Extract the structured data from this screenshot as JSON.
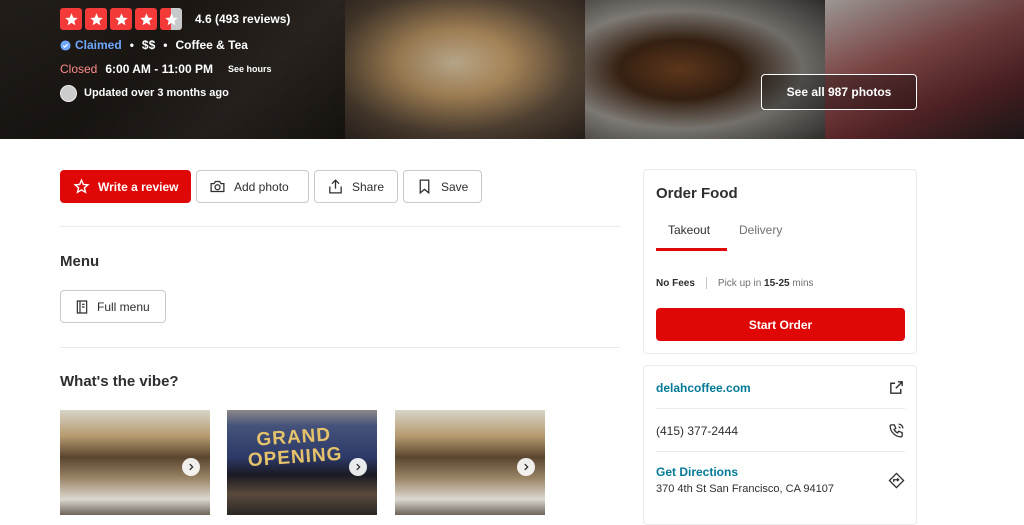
{
  "hero": {
    "rating_text": "4.6 (493 reviews)",
    "claimed": "Claimed",
    "price": "$$",
    "category": "Coffee & Tea",
    "status": "Closed",
    "hours": "6:00 AM - 11:00 PM",
    "see_hours": "See hours",
    "updated": "Updated over 3 months ago",
    "see_photos": "See all 987 photos",
    "star_color": "#f43939",
    "stars": 4.5
  },
  "actions": {
    "write_review": "Write a review",
    "add_photo": "Add photo",
    "share": "Share",
    "save": "Save"
  },
  "menu": {
    "title": "Menu",
    "full_menu": "Full menu"
  },
  "vibe": {
    "title": "What's the vibe?",
    "banner_text": "GRAND OPENING"
  },
  "order": {
    "title": "Order Food",
    "tabs": [
      "Takeout",
      "Delivery"
    ],
    "active_tab": "Takeout",
    "no_fees": "No Fees",
    "pickup_prefix": "Pick up in",
    "pickup_time": "15-25",
    "pickup_suffix": "mins",
    "start_order": "Start Order",
    "accent": "#e00707"
  },
  "info": {
    "website": "delahcoffee.com",
    "phone": "(415) 377-2444",
    "directions": "Get Directions",
    "address": "370 4th St San Francisco, CA 94107",
    "link_color": "#027a97"
  }
}
